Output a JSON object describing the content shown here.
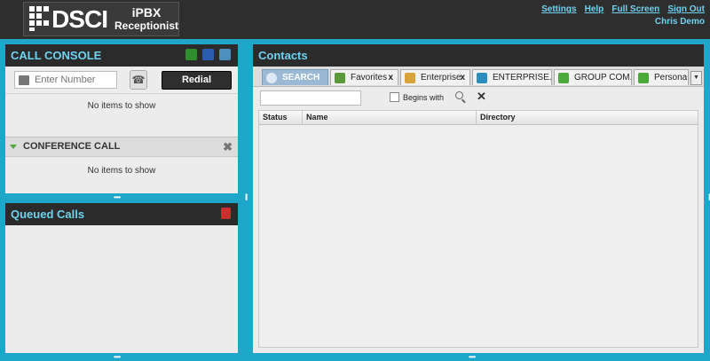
{
  "header": {
    "logo_text": "DSCI",
    "logo_line1": "iPBX",
    "logo_line2": "Receptionist",
    "links": [
      "Settings",
      "Help",
      "Full Screen",
      "Sign Out"
    ],
    "user_name": "Chris Demo"
  },
  "call_console": {
    "title": "CALL CONSOLE",
    "number_placeholder": "Enter Number",
    "redial_label": "Redial",
    "empty_text": "No items to show",
    "conference_title": "CONFERENCE CALL",
    "conference_empty": "No items to show"
  },
  "queued_calls": {
    "title": "Queued Calls"
  },
  "contacts": {
    "title": "Contacts",
    "tabs": [
      {
        "label": "SEARCH"
      },
      {
        "label": "Favorites",
        "close": "x"
      },
      {
        "label": "Enterprise",
        "close": "x"
      },
      {
        "label": "ENTERPRISE..."
      },
      {
        "label": "GROUP COM..."
      },
      {
        "label": "Persona"
      }
    ],
    "begins_with_label": "Begins with",
    "columns": [
      "Status",
      "Name",
      "Directory"
    ]
  },
  "colors": {
    "accent": "#1ea7c9",
    "header_bg": "#2e2e2e",
    "title_text": "#6ed2f0"
  }
}
